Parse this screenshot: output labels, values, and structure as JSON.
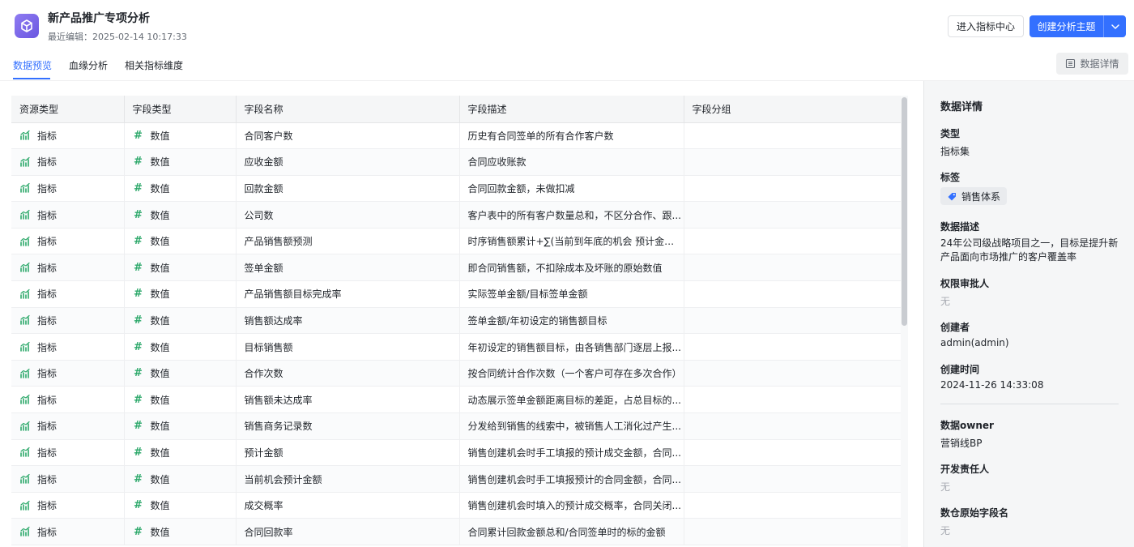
{
  "header": {
    "title": "新产品推广专项分析",
    "subtitle": "最近编辑：2025-02-14 10:17:33",
    "metric_center_label": "进入指标中心",
    "create_topic_label": "创建分析主题"
  },
  "tabs": [
    {
      "label": "数据预览",
      "active": true
    },
    {
      "label": "血缘分析",
      "active": false
    },
    {
      "label": "相关指标维度",
      "active": false
    }
  ],
  "detail_button_label": "数据详情",
  "table": {
    "columns": [
      "资源类型",
      "字段类型",
      "字段名称",
      "字段描述",
      "字段分组"
    ],
    "rows": [
      {
        "resource": "指标",
        "type": "数值",
        "name": "合同客户数",
        "desc": "历史有合同签单的所有合作客户数",
        "group": ""
      },
      {
        "resource": "指标",
        "type": "数值",
        "name": "应收金额",
        "desc": "合同应收账款",
        "group": ""
      },
      {
        "resource": "指标",
        "type": "数值",
        "name": "回款金额",
        "desc": "合同回款金额，未做扣减",
        "group": ""
      },
      {
        "resource": "指标",
        "type": "数值",
        "name": "公司数",
        "desc": "客户表中的所有客户数量总和，不区分合作、跟...",
        "group": ""
      },
      {
        "resource": "指标",
        "type": "数值",
        "name": "产品销售额预测",
        "desc": "时序销售额累计+∑(当前到年底的机会 预计金额*...",
        "group": ""
      },
      {
        "resource": "指标",
        "type": "数值",
        "name": "签单金额",
        "desc": "即合同销售额，不扣除成本及坏账的原始数值",
        "group": ""
      },
      {
        "resource": "指标",
        "type": "数值",
        "name": "产品销售额目标完成率",
        "desc": "实际签单金额/目标签单金额",
        "group": ""
      },
      {
        "resource": "指标",
        "type": "数值",
        "name": "销售额达成率",
        "desc": "签单金额/年初设定的销售额目标",
        "group": ""
      },
      {
        "resource": "指标",
        "type": "数值",
        "name": "目标销售额",
        "desc": "年初设定的销售额目标，由各销售部门逐层上报...",
        "group": ""
      },
      {
        "resource": "指标",
        "type": "数值",
        "name": "合作次数",
        "desc": "按合同统计合作次数（一个客户可存在多次合作）",
        "group": ""
      },
      {
        "resource": "指标",
        "type": "数值",
        "name": "销售额未达成率",
        "desc": "动态展示签单金额距离目标的差距，占总目标的...",
        "group": ""
      },
      {
        "resource": "指标",
        "type": "数值",
        "name": "销售商务记录数",
        "desc": "分发给到销售的线索中，被销售人工消化过产生...",
        "group": ""
      },
      {
        "resource": "指标",
        "type": "数值",
        "name": "预计金额",
        "desc": "销售创建机会时手工填报的预计成交金额，合同...",
        "group": ""
      },
      {
        "resource": "指标",
        "type": "数值",
        "name": "当前机会预计金额",
        "desc": "销售创建机会时手工填报预计的合同金额，合同...",
        "group": ""
      },
      {
        "resource": "指标",
        "type": "数值",
        "name": "成交概率",
        "desc": "销售创建机会时填入的预计成交概率，合同关闭...",
        "group": ""
      },
      {
        "resource": "指标",
        "type": "数值",
        "name": "合同回款率",
        "desc": "合同累计回款金额总和/合同签单时的标的金额",
        "group": ""
      }
    ]
  },
  "panel": {
    "title": "数据详情",
    "type_label": "类型",
    "type_value": "指标集",
    "tags_label": "标签",
    "tag_value": "销售体系",
    "desc_label": "数据描述",
    "desc_value": "24年公司级战略项目之一，目标是提升新产品面向市场推广的客户覆盖率",
    "approver_label": "权限审批人",
    "approver_value": "无",
    "creator_label": "创建者",
    "creator_value": "admin(admin)",
    "created_time_label": "创建时间",
    "created_time_value": "2024-11-26 14:33:08",
    "owner_label": "数据owner",
    "owner_value": "营销线BP",
    "dev_owner_label": "开发责任人",
    "dev_owner_value": "无",
    "raw_field_label": "数仓原始字段名",
    "raw_field_value": "无"
  },
  "colors": {
    "accent": "#3370ff",
    "app_icon": "#7b67ea",
    "metric_icon": "#2ea96b",
    "tag_icon": "#3370ff"
  }
}
